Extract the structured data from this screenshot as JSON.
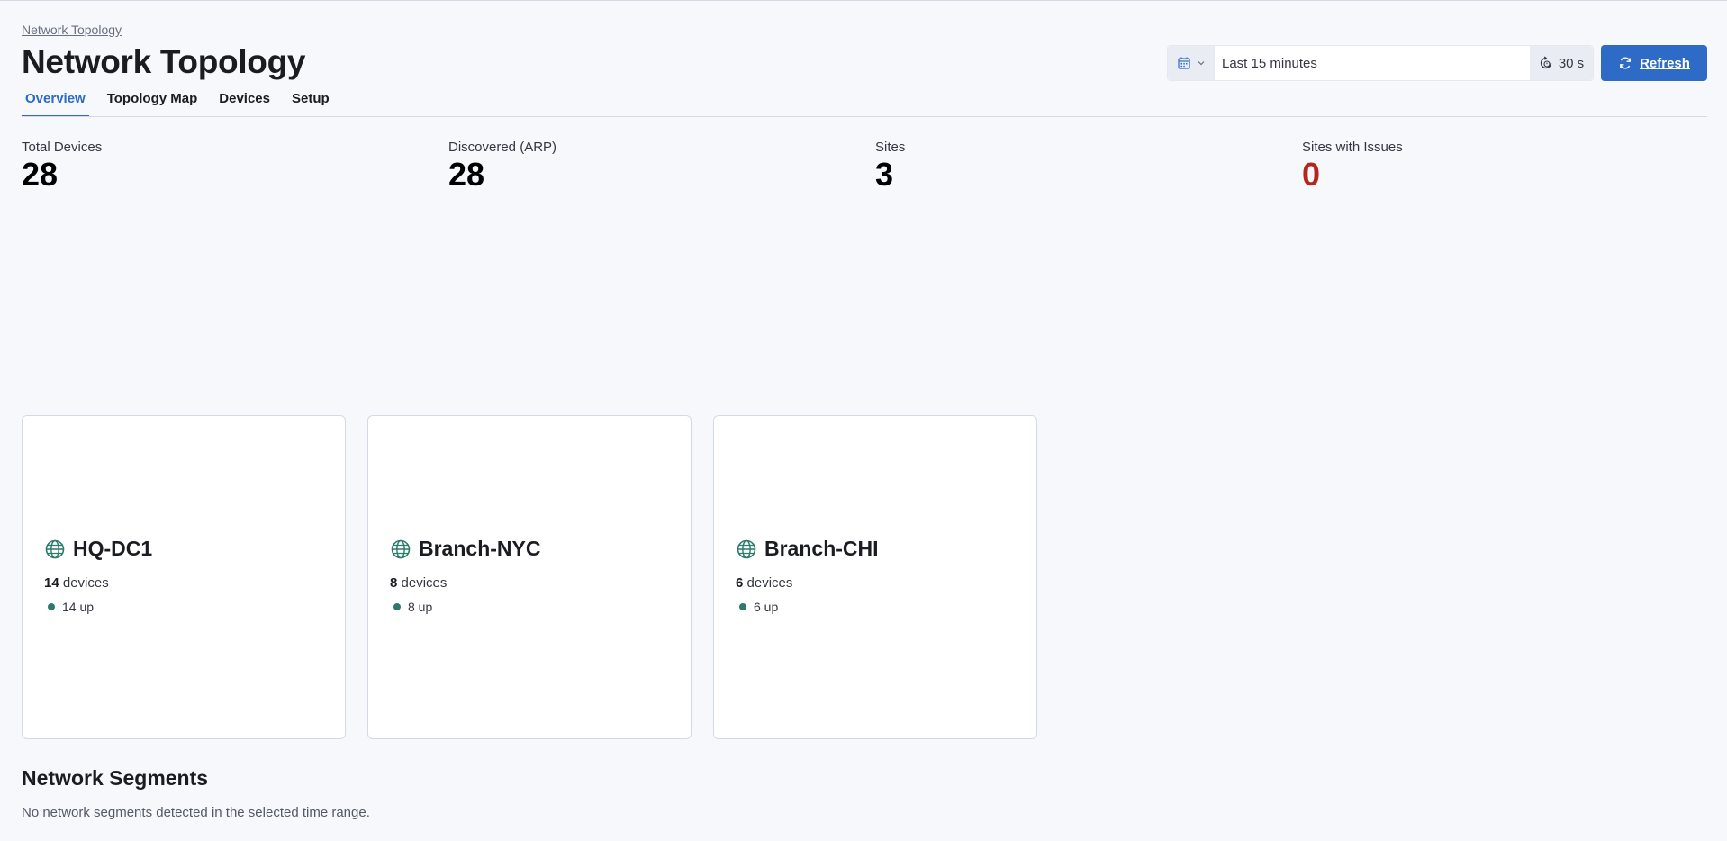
{
  "breadcrumb": "Network Topology",
  "page_title": "Network Topology",
  "tabs": [
    {
      "label": "Overview",
      "active": true
    },
    {
      "label": "Topology Map",
      "active": false
    },
    {
      "label": "Devices",
      "active": false
    },
    {
      "label": "Setup",
      "active": false
    }
  ],
  "time_picker": {
    "calendar_icon": "calendar-icon",
    "range": "Last 15 minutes",
    "interval": "30 s"
  },
  "refresh": {
    "label": "Refresh",
    "icon": "refresh-icon"
  },
  "stats": [
    {
      "label": "Total Devices",
      "value": "28"
    },
    {
      "label": "Discovered (ARP)",
      "value": "28"
    },
    {
      "label": "Sites",
      "value": "3"
    },
    {
      "label": "Sites with Issues",
      "value": "0"
    }
  ],
  "colors": {
    "accent": "#2e6bc6",
    "danger": "#b4251d",
    "status_up": "#2c7a6c"
  },
  "sites": [
    {
      "name": "HQ-DC1",
      "device_count": "14",
      "devices_suffix": "devices",
      "up_label": "14 up"
    },
    {
      "name": "Branch-NYC",
      "device_count": "8",
      "devices_suffix": "devices",
      "up_label": "8 up"
    },
    {
      "name": "Branch-CHI",
      "device_count": "6",
      "devices_suffix": "devices",
      "up_label": "6 up"
    }
  ],
  "segments": {
    "title": "Network Segments",
    "empty_message": "No network segments detected in the selected time range."
  }
}
